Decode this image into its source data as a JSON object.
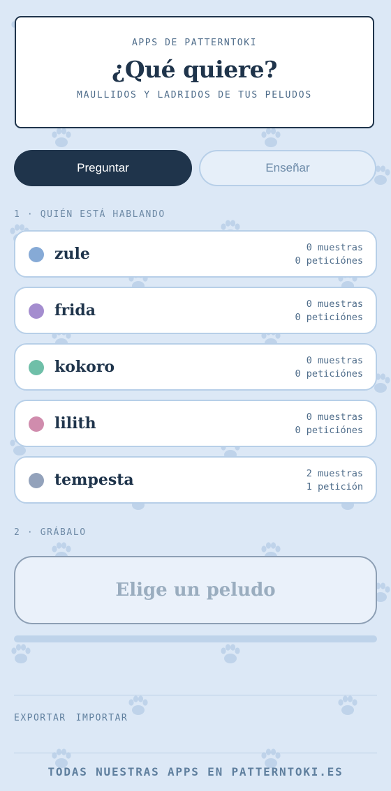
{
  "header": {
    "kicker": "APPS DE PATTERNTOKI",
    "title": "¿Qué quiere?",
    "subtitle": "MAULLIDOS Y LADRIDOS DE TUS PELUDOS"
  },
  "tabs": [
    {
      "label": "Preguntar",
      "active": true
    },
    {
      "label": "Enseñar",
      "active": false
    }
  ],
  "step1_label": "1 · QUIÉN ESTÁ HABLANDO",
  "pets": [
    {
      "name": "zule",
      "color": "#86aad6",
      "samples": "0 muestras",
      "requests": "0 peticiónes"
    },
    {
      "name": "frida",
      "color": "#a48dcf",
      "samples": "0 muestras",
      "requests": "0 peticiónes"
    },
    {
      "name": "kokoro",
      "color": "#6fbfa8",
      "samples": "0 muestras",
      "requests": "0 peticiónes"
    },
    {
      "name": "lilith",
      "color": "#d08cad",
      "samples": "0 muestras",
      "requests": "0 peticiónes"
    },
    {
      "name": "tempesta",
      "color": "#93a2bb",
      "samples": "2 muestras",
      "requests": "1 petición"
    }
  ],
  "step2_label": "2 · GRÁBALO",
  "record_button_label": "Elige un peludo",
  "progress": 0,
  "footer": {
    "export_label": "EXPORTAR",
    "import_label": "IMPORTAR",
    "credit": "TODAS NUESTRAS APPS EN PATTERNTOKI.ES"
  },
  "icons": {
    "background_pattern": "paw-print-icon"
  }
}
